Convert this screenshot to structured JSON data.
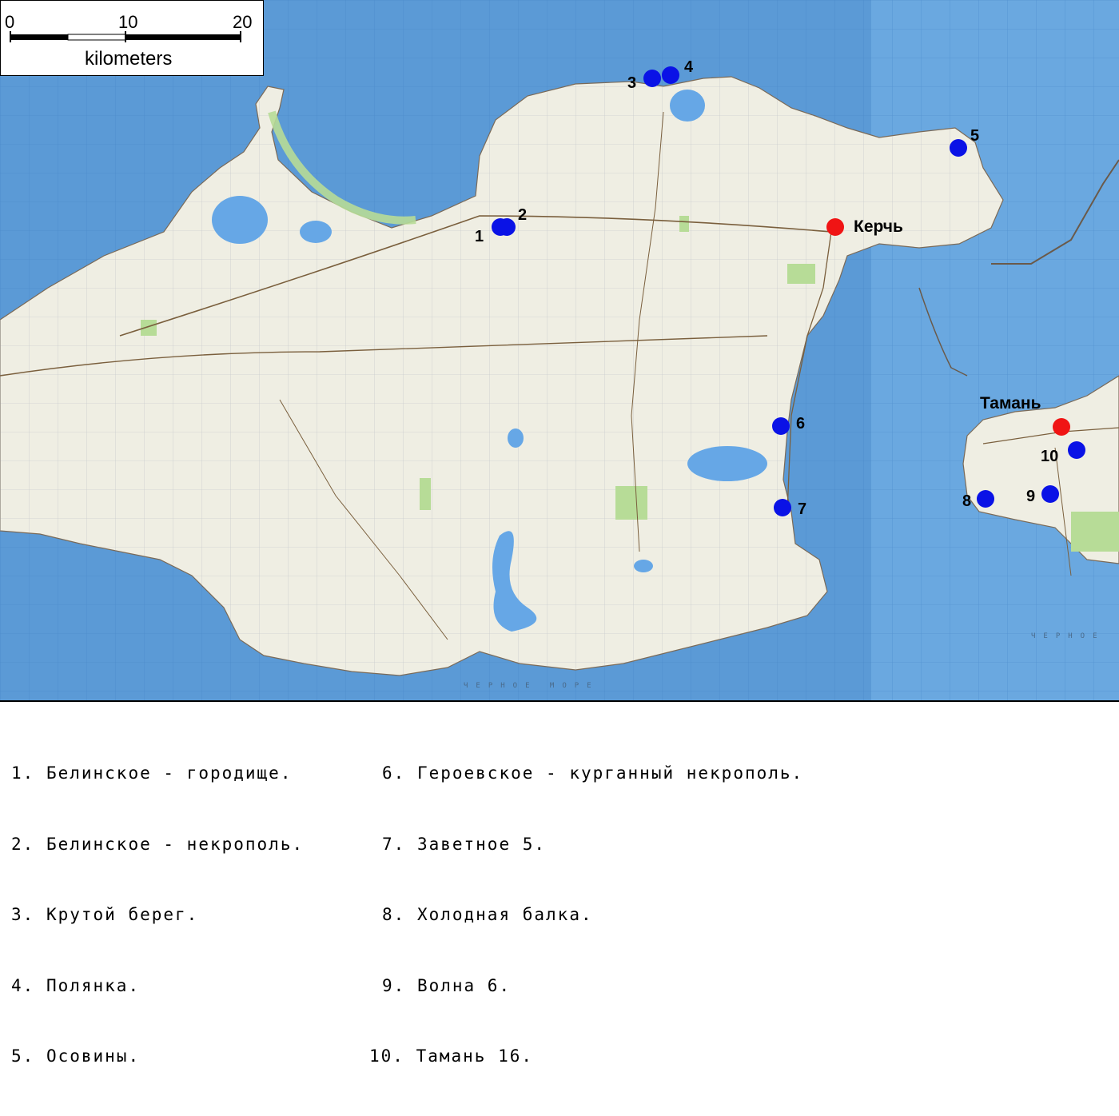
{
  "scale_bar": {
    "tick_0": "0",
    "tick_10": "10",
    "tick_20": "20",
    "unit": "kilometers"
  },
  "colors": {
    "sea": "#5b9ad6",
    "land": "#efeee3",
    "site_marker": "#0a12e6",
    "city_marker": "#f01414",
    "forest": "#b7dc97",
    "lake": "#66a7e6"
  },
  "map": {
    "sea_label": "ЧЕРНОЕ МОРЕ",
    "sea_label_right": "ЧЕРНОЕ",
    "cities": [
      {
        "name": "Керчь"
      },
      {
        "name": "Тамань"
      }
    ],
    "sites": [
      {
        "number": "1"
      },
      {
        "number": "2"
      },
      {
        "number": "3"
      },
      {
        "number": "4"
      },
      {
        "number": "5"
      },
      {
        "number": "6"
      },
      {
        "number": "7"
      },
      {
        "number": "8"
      },
      {
        "number": "9"
      },
      {
        "number": "10"
      }
    ]
  },
  "legend": {
    "items": [
      {
        "num": "1.",
        "name": "Белинское - городище."
      },
      {
        "num": "2.",
        "name": "Белинское - некрополь."
      },
      {
        "num": "3.",
        "name": "Крутой берег."
      },
      {
        "num": "4.",
        "name": "Полянка."
      },
      {
        "num": "5.",
        "name": "Осовины."
      },
      {
        "num": "6.",
        "name": "Героевское - курганный некрополь."
      },
      {
        "num": "7.",
        "name": "Заветное 5."
      },
      {
        "num": "8.",
        "name": "Холодная балка."
      },
      {
        "num": "9.",
        "name": "Волна 6."
      },
      {
        "num": "10.",
        "name": "Тамань 16."
      }
    ]
  }
}
